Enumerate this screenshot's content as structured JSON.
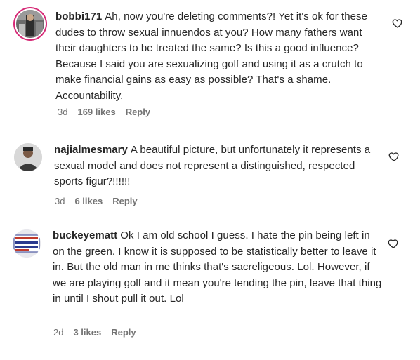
{
  "comments": [
    {
      "username": "bobbi171",
      "text": "Ah, now you're deleting comments?! Yet it's ok for these dudes to throw sexual innuendos at you? How many fathers want their daughters to be treated the same? Is this a good influence? Because I said you are sexualizing golf and using it as a crutch to make financial gains as easy as possible? That's a shame. Accountability.",
      "time": "3d",
      "likes": "169 likes",
      "reply": "Reply",
      "avatar_icon": "user-avatar-story-ring"
    },
    {
      "username": "najialmesmary",
      "text": "A beautiful picture, but unfortunately it represents a sexual model and does not represent a distinguished, respected sports figur?!!!!!!",
      "time": "3d",
      "likes": "6 likes",
      "reply": "Reply",
      "avatar_icon": "user-avatar"
    },
    {
      "username": "buckeyematt",
      "text": "Ok I am old school I guess. I hate the pin being left in on the green. I know it is supposed to be statistically better to leave it in. But the old man in me thinks that's sacreligeous. Lol. However, if we are playing golf and it mean you're tending the pin, leave that thing in until I shout pull it out. Lol",
      "time": "2d",
      "likes": "3 likes",
      "reply": "Reply",
      "avatar_icon": "user-avatar"
    }
  ],
  "like_icon": "heart-outline-icon",
  "colors": {
    "text": "#262626",
    "meta": "#737373",
    "story_ring": "#d62976"
  }
}
